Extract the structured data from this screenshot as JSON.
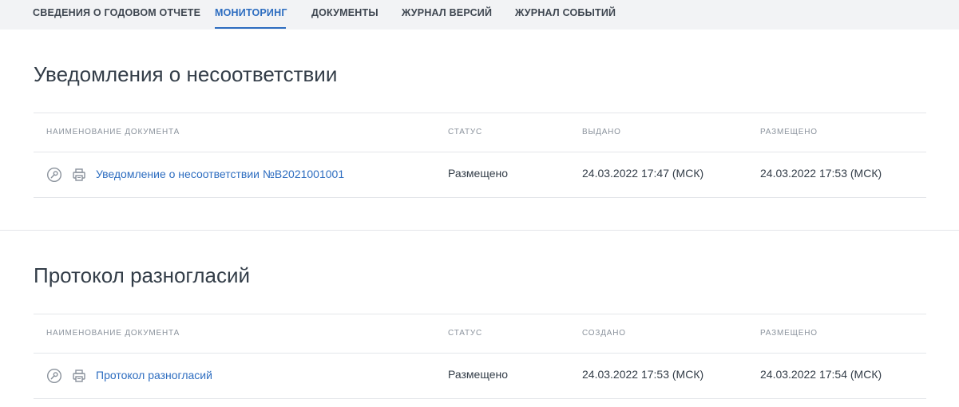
{
  "tabs": [
    {
      "label": "СВЕДЕНИЯ О ГОДОВОМ ОТЧЕТЕ"
    },
    {
      "label": "МОНИТОРИНГ",
      "active": true
    },
    {
      "label": "ДОКУМЕНТЫ"
    },
    {
      "label": "ЖУРНАЛ ВЕРСИЙ"
    },
    {
      "label": "ЖУРНАЛ СОБЫТИЙ"
    }
  ],
  "sections": [
    {
      "title": "Уведомления о несоответствии",
      "columns": [
        "НАИМЕНОВАНИЕ ДОКУМЕНТА",
        "СТАТУС",
        "ВЫДАНО",
        "РАЗМЕЩЕНО"
      ],
      "rows": [
        {
          "icons": [
            "signature-icon",
            "print-icon"
          ],
          "name": "Уведомление о несоответствии №B2021001001",
          "status": "Размещено",
          "date1": "24.03.2022 17:47 (МСК)",
          "date2": "24.03.2022 17:53 (МСК)"
        }
      ]
    },
    {
      "title": "Протокол разногласий",
      "columns": [
        "НАИМЕНОВАНИЕ ДОКУМЕНТА",
        "СТАТУС",
        "СОЗДАНО",
        "РАЗМЕЩЕНО"
      ],
      "rows": [
        {
          "icons": [
            "signature-icon",
            "print-icon"
          ],
          "name": "Протокол разногласий",
          "status": "Размещено",
          "date1": "24.03.2022 17:53 (МСК)",
          "date2": "24.03.2022 17:54 (МСК)"
        }
      ]
    }
  ],
  "colors": {
    "accent": "#2d6dc0",
    "text": "#333d48",
    "muted": "#8a929c",
    "tabbar_bg": "#f2f3f5",
    "divider": "#e4e6ea"
  }
}
